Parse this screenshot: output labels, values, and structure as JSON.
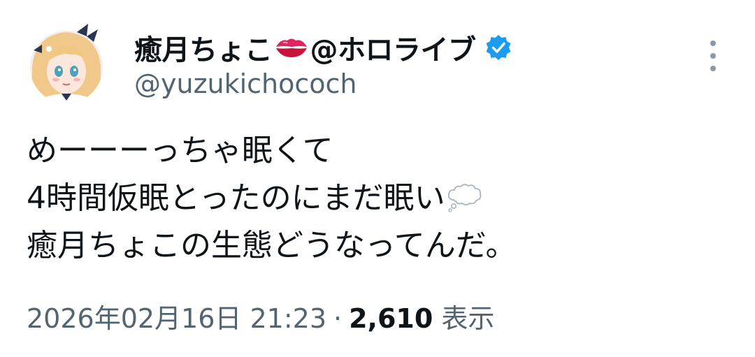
{
  "author": {
    "display_name": "癒月ちょこ",
    "display_name_suffix": "@ホロライブ",
    "handle": "@yuzukichococh",
    "verified": true,
    "name_emoji": "kiss-mark-icon",
    "verified_color": "#1d9bf0"
  },
  "tweet": {
    "lines": [
      "めーーーっちゃ眠くて",
      "4時間仮眠とったのにまだ眠い",
      "癒月ちょこの生態どうなってんだ。"
    ],
    "line2_emoji": "thought-balloon-icon"
  },
  "meta": {
    "timestamp": "2026年02月16日 21:23",
    "separator": "·",
    "view_count": "2,610",
    "view_label": "表示"
  },
  "colors": {
    "text_primary": "#0f1419",
    "text_secondary": "#536471",
    "kiss_red": "#e0245e"
  }
}
